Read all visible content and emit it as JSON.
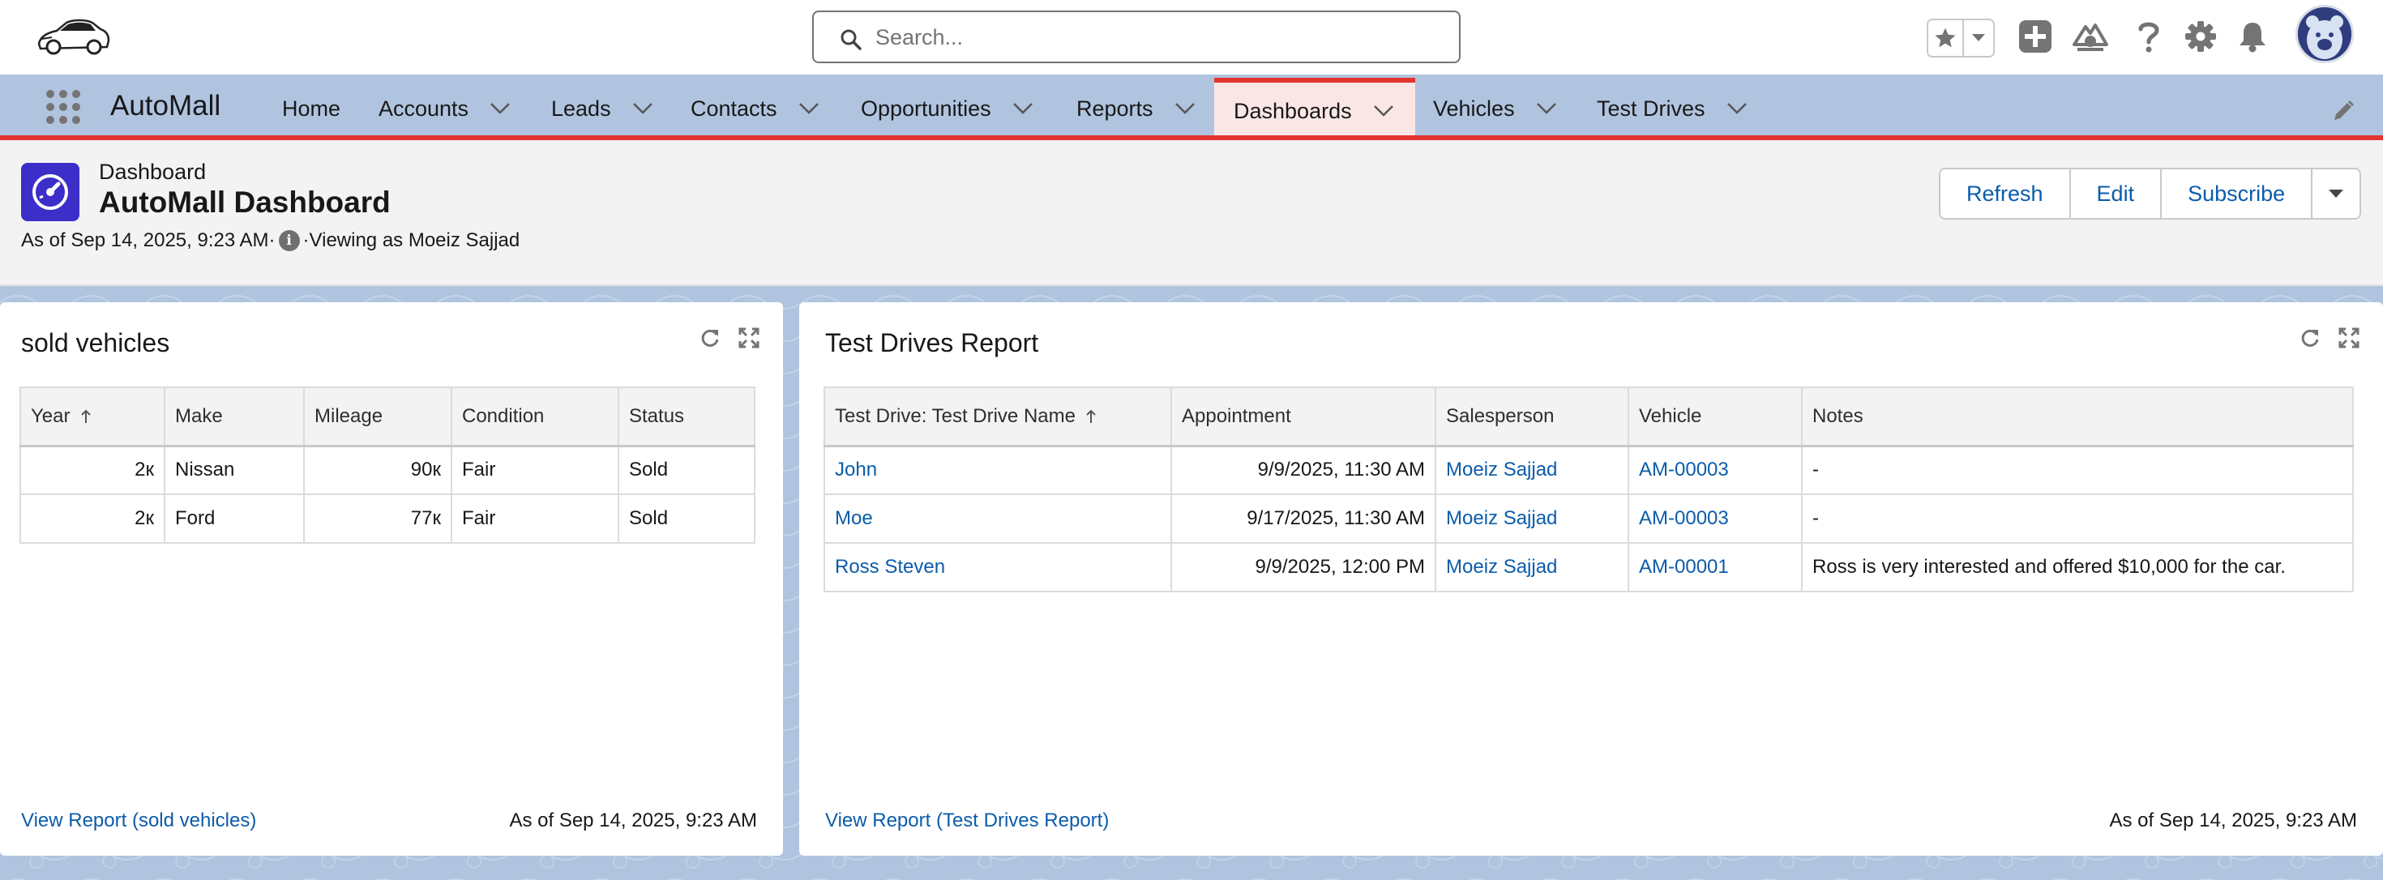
{
  "header": {
    "search_placeholder": "Search...",
    "icons": [
      "car-logo-icon",
      "favorites-star-icon",
      "chevron-down-icon",
      "add-icon",
      "trailhead-icon",
      "help-icon",
      "gear-icon",
      "bell-icon",
      "avatar-bear-icon"
    ]
  },
  "nav": {
    "app_name": "AutoMall",
    "tabs": [
      {
        "label": "Home",
        "has_menu": false
      },
      {
        "label": "Accounts",
        "has_menu": true
      },
      {
        "label": "Leads",
        "has_menu": true
      },
      {
        "label": "Contacts",
        "has_menu": true
      },
      {
        "label": "Opportunities",
        "has_menu": true
      },
      {
        "label": "Reports",
        "has_menu": true
      },
      {
        "label": "Dashboards",
        "has_menu": true,
        "active": true
      },
      {
        "label": "Vehicles",
        "has_menu": true
      },
      {
        "label": "Test Drives",
        "has_menu": true
      }
    ],
    "accent_color": "#e3342f"
  },
  "dashboard": {
    "type_label": "Dashboard",
    "title": "AutoMall Dashboard",
    "as_of": "As of Sep 14, 2025, 9:23 AM·",
    "viewing_as": "·Viewing as Moeiz Sajjad",
    "buttons": {
      "refresh": "Refresh",
      "edit": "Edit",
      "subscribe": "Subscribe"
    }
  },
  "cards": {
    "sold": {
      "title": "sold vehicles",
      "columns": [
        "Year",
        "Make",
        "Mileage",
        "Condition",
        "Status"
      ],
      "rows": [
        [
          "2к",
          "Nissan",
          "90к",
          "Fair",
          "Sold"
        ],
        [
          "2к",
          "Ford",
          "77к",
          "Fair",
          "Sold"
        ]
      ],
      "view_report": "View Report (sold vehicles)",
      "as_of": "As of Sep 14, 2025, 9:23 AM"
    },
    "test_drives": {
      "title": "Test Drives Report",
      "columns": [
        "Test Drive: Test Drive Name",
        "Appointment",
        "Salesperson",
        "Vehicle",
        "Notes"
      ],
      "rows": [
        [
          "John",
          "9/9/2025, 11:30 AM",
          "Moeiz Sajjad",
          "AM-00003",
          "-"
        ],
        [
          "Moe",
          "9/17/2025, 11:30 AM",
          "Moeiz Sajjad",
          "AM-00003",
          "-"
        ],
        [
          "Ross Steven",
          "9/9/2025, 12:00 PM",
          "Moeiz Sajjad",
          "AM-00001",
          "Ross is very interested and offered $10,000 for the car."
        ]
      ],
      "view_report": "View Report (Test Drives Report)",
      "as_of": "As of Sep 14, 2025, 9:23 AM"
    }
  },
  "colors": {
    "link": "#0b5cab",
    "dashboard_icon": "#3c2ec8",
    "canvas": "#b0c4df"
  }
}
